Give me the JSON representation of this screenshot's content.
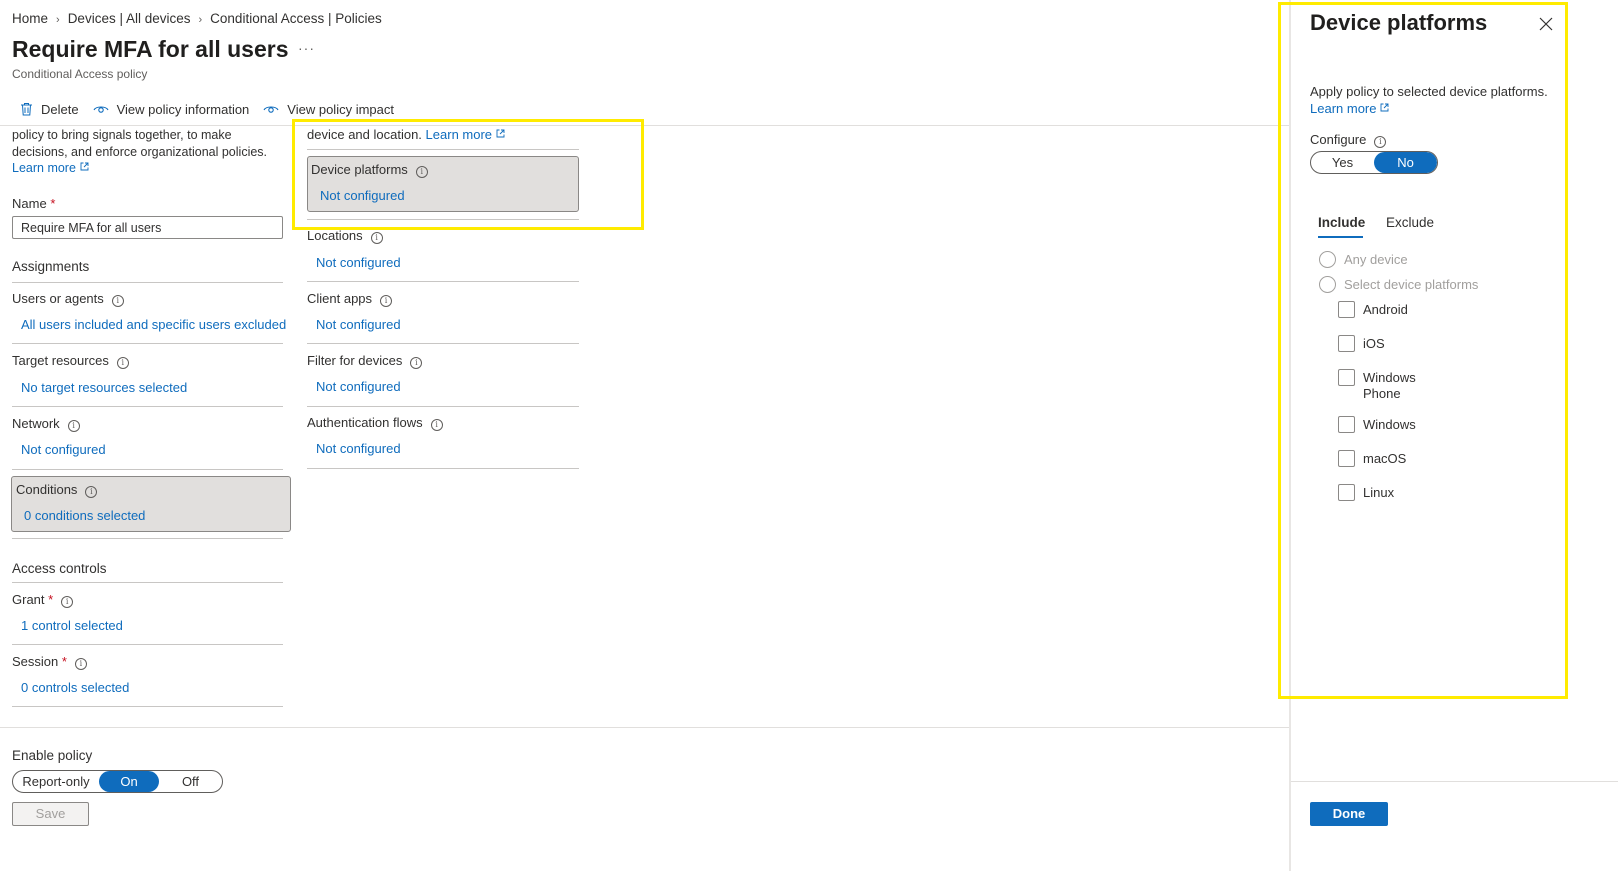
{
  "breadcrumb": [
    "Home",
    "Devices | All devices",
    "Conditional Access | Policies"
  ],
  "page": {
    "title": "Require MFA for all users",
    "more": "···",
    "subtitle": "Conditional Access policy"
  },
  "toolbar": {
    "delete_label": "Delete",
    "view_info_label": "View policy information",
    "view_impact_label": "View policy impact"
  },
  "left": {
    "description": "policy to bring signals together, to make decisions, and enforce organizational policies.",
    "learn_more": "Learn more",
    "name_label": "Name",
    "required_mark": "*",
    "name_value": "Require MFA for all users",
    "assignments_heading": "Assignments",
    "items": [
      {
        "label": "Users or agents",
        "value": "All users included and specific users excluded"
      },
      {
        "label": "Target resources",
        "value": "No target resources selected"
      },
      {
        "label": "Network",
        "value": "Not configured"
      },
      {
        "label": "Conditions",
        "value": "0 conditions selected"
      }
    ],
    "access_controls_heading": "Access controls",
    "controls": [
      {
        "label": "Grant",
        "value": "1 control selected"
      },
      {
        "label": "Session",
        "value": "0 controls selected"
      }
    ]
  },
  "middle": {
    "top_text": "device and location.",
    "learn_more": "Learn more",
    "items": [
      {
        "label": "Device platforms",
        "value": "Not configured"
      },
      {
        "label": "Locations",
        "value": "Not configured"
      },
      {
        "label": "Client apps",
        "value": "Not configured"
      },
      {
        "label": "Filter for devices",
        "value": "Not configured"
      },
      {
        "label": "Authentication flows",
        "value": "Not configured"
      }
    ]
  },
  "enable_policy": {
    "label": "Enable policy",
    "options": [
      "Report-only",
      "On",
      "Off"
    ],
    "selected": "On",
    "save_label": "Save"
  },
  "panel": {
    "title": "Device platforms",
    "description": "Apply policy to selected device platforms.",
    "learn_more": "Learn more",
    "configure_label": "Configure",
    "configure_options": [
      "Yes",
      "No"
    ],
    "configure_selected": "No",
    "tabs": [
      "Include",
      "Exclude"
    ],
    "active_tab": "Include",
    "radios": [
      "Any device",
      "Select device platforms"
    ],
    "platforms": [
      "Android",
      "iOS",
      "Windows Phone",
      "Windows",
      "macOS",
      "Linux"
    ],
    "done_label": "Done"
  },
  "colors": {
    "accent": "#0f6cbd",
    "highlight": "#ffeb00",
    "required": "#c50f1f",
    "selected_box": "#e1dfdd"
  }
}
